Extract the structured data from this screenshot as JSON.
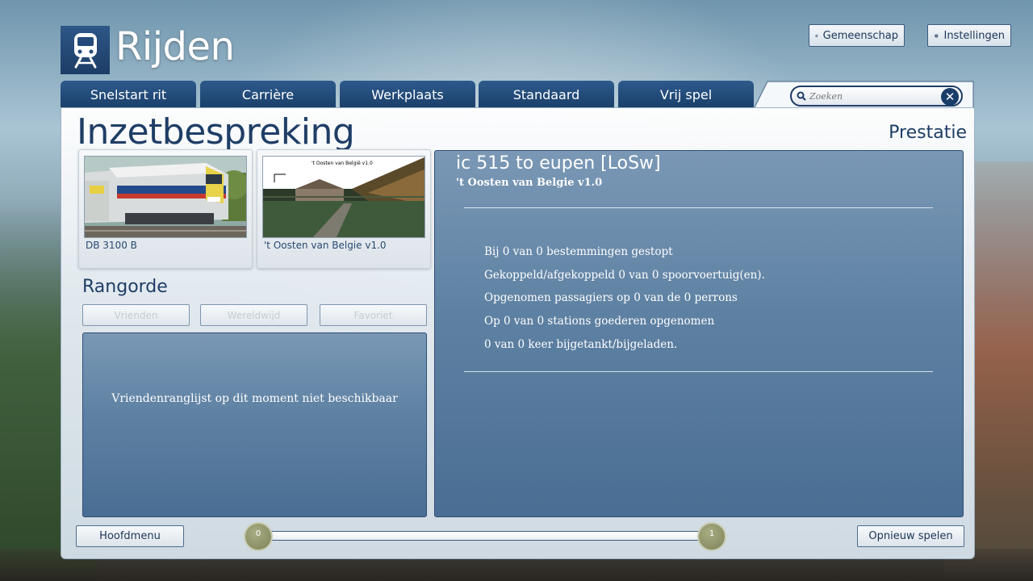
{
  "app": {
    "title": "Rijden",
    "logo_icon": "train-icon"
  },
  "header": {
    "community_label": "Gemeenschap",
    "community_icon": "globe-icon",
    "settings_label": "Instellingen",
    "settings_icon": "gear-icon"
  },
  "tabs": [
    {
      "label": "Snelstart rit"
    },
    {
      "label": "Carrière"
    },
    {
      "label": "Werkplaats"
    },
    {
      "label": "Standaard"
    },
    {
      "label": "Vrij spel"
    }
  ],
  "search": {
    "placeholder": "Zoeken",
    "search_icon": "magnifier-icon",
    "clear_icon": "close-icon"
  },
  "page": {
    "title": "Inzetbespreking",
    "performance_title": "Prestatie"
  },
  "thumbnails": {
    "loco_caption": "DB 3100 B",
    "route_caption": "'t Oosten van Belgie v1.0",
    "route_image_text": "'t Oosten van België v1.0"
  },
  "ranking": {
    "title": "Rangorde",
    "buttons": [
      {
        "label": "Vrienden"
      },
      {
        "label": "Wereldwijd"
      },
      {
        "label": "Favoriet"
      }
    ],
    "empty_message": "Vriendenranglijst op dit moment niet beschikbaar"
  },
  "scenario": {
    "title": "ic 515 to eupen [LoSw]",
    "route": "'t Oosten van Belgie v1.0",
    "stats": [
      "Bij 0 van 0 bestemmingen gestopt",
      "Gekoppeld/afgekoppeld 0 van 0 spoorvoertuig(en).",
      "Opgenomen passagiers op 0 van de 0 perrons",
      "Op 0 van 0 stations goederen opgenomen",
      "0 van 0 keer bijgetankt/bijgeladen."
    ]
  },
  "footer": {
    "main_menu_label": "Hoofdmenu",
    "replay_label": "Opnieuw spelen",
    "progress_start": "0",
    "progress_end": "1"
  },
  "colors": {
    "accent_dark_blue": "#1a3f6a",
    "panel_blue": "#5e81a3",
    "progress_node": "#8e9368"
  }
}
